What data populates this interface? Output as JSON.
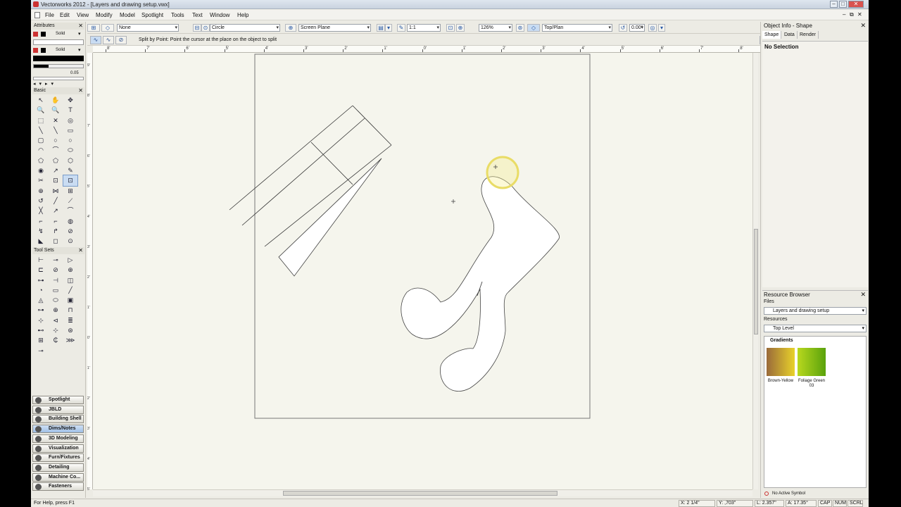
{
  "window": {
    "title": "Vectorworks 2012 - [Layers and drawing setup.vwx]",
    "min": "–",
    "max": "□",
    "close": "✕",
    "doc_min": "–",
    "doc_max": "⧉",
    "doc_close": "✕"
  },
  "menu": [
    "File",
    "Edit",
    "View",
    "Modify",
    "Model",
    "Spotlight",
    "Tools",
    "Text",
    "Window",
    "Help"
  ],
  "toolbar": {
    "class": "None",
    "layer": "Circle",
    "plane": "Screen Plane",
    "scale": "1:1",
    "zoom": "126%",
    "view": "Top/Plan",
    "rotation": "0.00°"
  },
  "modebar": {
    "hint": "Split by Point: Point the cursor at the place on the object to split"
  },
  "ruler": {
    "h_labels": [
      "8'",
      "7'",
      "6'",
      "5'",
      "4'",
      "3'",
      "2'",
      "1'",
      "0'",
      "1'",
      "2'",
      "3'",
      "4'",
      "5'",
      "6'",
      "7'",
      "8'"
    ],
    "v_labels": [
      "9'",
      "8'",
      "7'",
      "6'",
      "5'",
      "4'",
      "3'",
      "2'",
      "1'",
      "0'",
      "1'",
      "2'",
      "3'",
      "4'",
      "5'"
    ]
  },
  "attributes": {
    "title": "Attributes",
    "close": "✕",
    "fill": "Solid",
    "pen": "Solid",
    "thickness": "0.05"
  },
  "basic": {
    "title": "Basic",
    "close": "✕",
    "tools": [
      "↖",
      "✋",
      "✥",
      "🔍",
      "🔍",
      "T",
      "⬚",
      "✕",
      "◎",
      "╲",
      "╲",
      "▭",
      "▢",
      "○",
      "○",
      "◠",
      "⌒",
      "⬭",
      "⬠",
      "⬠",
      "⬡",
      "◉",
      "↗",
      "✎",
      "✂",
      "⊡",
      "⊡",
      "⊕",
      "⋈",
      "⊞",
      "↺",
      "╱",
      "⟋",
      "╳",
      "↗",
      "⌒",
      "⌐",
      "⌐",
      "◍",
      "↯",
      "↱",
      "⊘",
      "◣",
      "◻",
      "⊙"
    ]
  },
  "toolsets": {
    "title": "Tool Sets",
    "close": "✕",
    "tools": [
      "⊢",
      "⊸",
      "▷",
      "⊏",
      "⊘",
      "⊕",
      "⊶",
      "⊣",
      "◫",
      "◔",
      "▭",
      "╱",
      "◬",
      "⬭",
      "▣",
      "⊶",
      "⊕",
      "⊓",
      "⊹",
      "⊲",
      "≣",
      "⊷",
      "⊹",
      "⊛",
      "⊞",
      "₵",
      "⋙",
      "⊸"
    ],
    "sets": [
      {
        "label": "Spotlight",
        "active": false
      },
      {
        "label": "JBLD",
        "active": false
      },
      {
        "label": "Building Shell",
        "active": false
      },
      {
        "label": "Dims/Notes",
        "active": true
      },
      {
        "label": "3D Modeling",
        "active": false
      },
      {
        "label": "Visualization",
        "active": false
      },
      {
        "label": "Furn/Fixtures",
        "active": false
      },
      {
        "label": "Detailing",
        "active": false
      },
      {
        "label": "Machine Co...",
        "active": false
      },
      {
        "label": "Fasteners",
        "active": false
      }
    ]
  },
  "obj_info": {
    "title": "Object Info - Shape",
    "close": "✕",
    "tabs": [
      "Shape",
      "Data",
      "Render"
    ],
    "selection": "No Selection"
  },
  "resource_browser": {
    "title": "Resource Browser",
    "close": "✕",
    "files_label": "Files",
    "files_value": "Layers and drawing setup",
    "resources_label": "Resources",
    "resources_value": "Top Level",
    "section": "Gradients",
    "gradients": [
      {
        "label": "Brown-Yellow",
        "c1": "#9a6a3a",
        "c2": "#e8d22a"
      },
      {
        "label": "Foliage Green 03",
        "c1": "#b8d81e",
        "c2": "#5aa20c"
      }
    ],
    "symbol": "No Active Symbol"
  },
  "status": {
    "help": "For Help, press F1",
    "x": "X: 2 1/4\"",
    "y": "Y: ,703\"",
    "l": "L: 2.357\"",
    "a": "A: 17.35°",
    "cap": "CAP",
    "num": "NUM",
    "scrl": "SCRL"
  }
}
